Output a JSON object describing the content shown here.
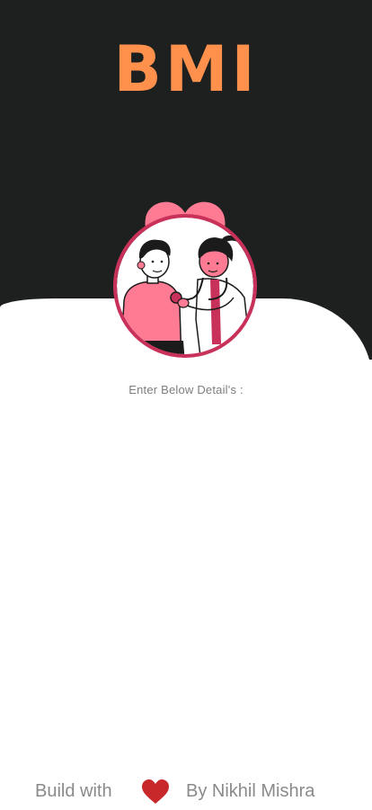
{
  "header": {
    "title": "BMI"
  },
  "form": {
    "prompt": "Enter Below Detail's :"
  },
  "footer": {
    "prefix": "Build with",
    "suffix": "By Nikhil Mishra",
    "heart_icon": "heart-icon"
  },
  "colors": {
    "background_dark": "#1e2020",
    "accent_orange": "#ff914d",
    "heart_pink": "#ff7b93",
    "ring_crimson": "#c8315a",
    "heart_red": "#c8282a",
    "muted_text": "#7d7d7d"
  }
}
